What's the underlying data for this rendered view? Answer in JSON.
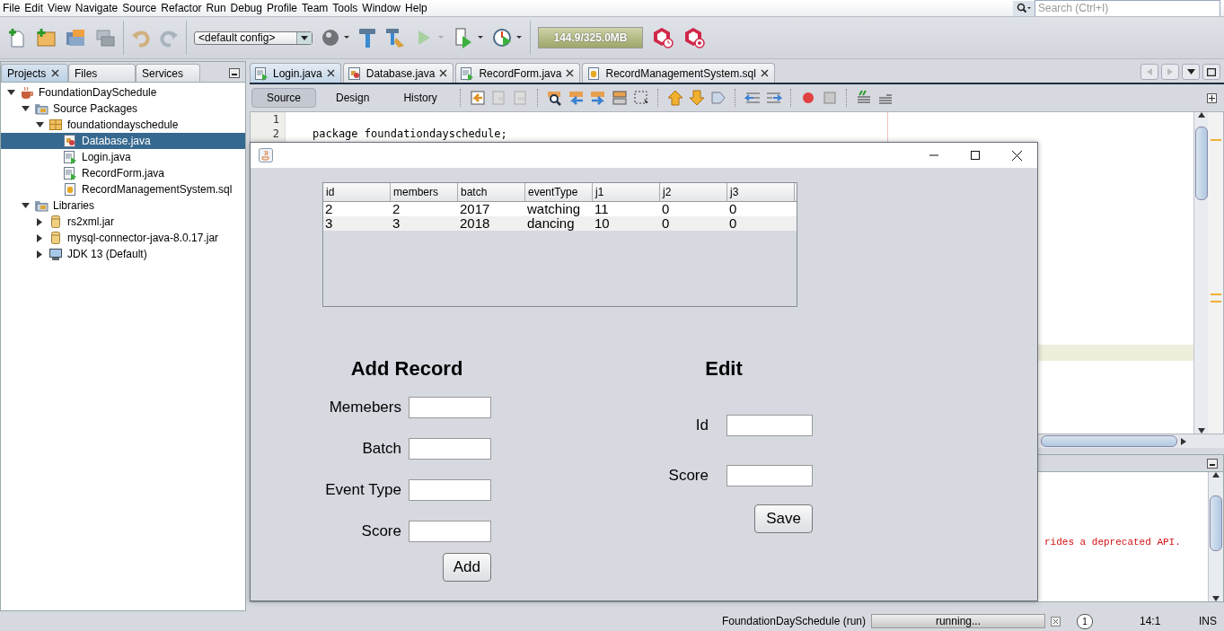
{
  "menu": [
    "File",
    "Edit",
    "View",
    "Navigate",
    "Source",
    "Refactor",
    "Run",
    "Debug",
    "Profile",
    "Team",
    "Tools",
    "Window",
    "Help"
  ],
  "search": {
    "placeholder": "Search (Ctrl+I)"
  },
  "toolbar": {
    "config": "<default config>",
    "memory": "144.9/325.0MB"
  },
  "project_tabs": [
    {
      "label": "Projects",
      "selected": true
    },
    {
      "label": "Files",
      "selected": false
    },
    {
      "label": "Services",
      "selected": false
    }
  ],
  "tree": [
    {
      "label": "FoundationDaySchedule",
      "kind": "project",
      "expanded": true,
      "selected": false,
      "children": [
        {
          "label": "Source Packages",
          "kind": "folder",
          "expanded": true,
          "selected": false,
          "children": [
            {
              "label": "foundationdayschedule",
              "kind": "package",
              "expanded": true,
              "selected": false,
              "children": [
                {
                  "label": "Database.java",
                  "kind": "java-db",
                  "selected": true
                },
                {
                  "label": "Login.java",
                  "kind": "java-run",
                  "selected": false
                },
                {
                  "label": "RecordForm.java",
                  "kind": "java-run",
                  "selected": false
                },
                {
                  "label": "RecordManagementSystem.sql",
                  "kind": "sql",
                  "selected": false
                }
              ]
            }
          ]
        },
        {
          "label": "Libraries",
          "kind": "folder",
          "expanded": true,
          "selected": false,
          "children": [
            {
              "label": "rs2xml.jar",
              "kind": "jar",
              "expanded": false,
              "selected": false
            },
            {
              "label": "mysql-connector-java-8.0.17.jar",
              "kind": "jar",
              "expanded": false,
              "selected": false
            },
            {
              "label": "JDK 13 (Default)",
              "kind": "jdk",
              "expanded": false,
              "selected": false
            }
          ]
        }
      ]
    }
  ],
  "editor_tabs": [
    {
      "label": "Login.java",
      "kind": "java-run",
      "selected": true
    },
    {
      "label": "Database.java",
      "kind": "java-db",
      "selected": false
    },
    {
      "label": "RecordForm.java",
      "kind": "java-run",
      "selected": false
    },
    {
      "label": "RecordManagementSystem.sql",
      "kind": "sql",
      "selected": false
    }
  ],
  "view_modes": [
    {
      "label": "Source",
      "selected": true
    },
    {
      "label": "Design",
      "selected": false
    },
    {
      "label": "History",
      "selected": false
    }
  ],
  "code_lines": [
    {
      "number": "1"
    },
    {
      "number": "2",
      "text": "package foundationdayschedule;"
    }
  ],
  "output": {
    "text": "rides a deprecated API."
  },
  "status_bar": {
    "task": "FoundationDaySchedule (run)",
    "progress": {
      "text": "running...",
      "level": 1
    },
    "notifications": "1",
    "position": "14:1",
    "mode": "INS"
  },
  "dialog": {
    "table": {
      "columns": [
        "id",
        "members",
        "batch",
        "eventType",
        "j1",
        "j2",
        "j3"
      ],
      "rows": [
        [
          "2",
          "2",
          "2017",
          "watching",
          "11",
          "0",
          "0"
        ],
        [
          "3",
          "3",
          "2018",
          "dancing",
          "10",
          "0",
          "0"
        ]
      ]
    },
    "add_form": {
      "title": "Add Record",
      "fields": [
        {
          "label": "Memebers"
        },
        {
          "label": "Batch"
        },
        {
          "label": "Event Type"
        },
        {
          "label": "Score"
        }
      ],
      "button": "Add"
    },
    "edit_form": {
      "title": "Edit",
      "fields": [
        {
          "label": "Id"
        },
        {
          "label": "Score"
        }
      ],
      "button": "Save"
    }
  }
}
